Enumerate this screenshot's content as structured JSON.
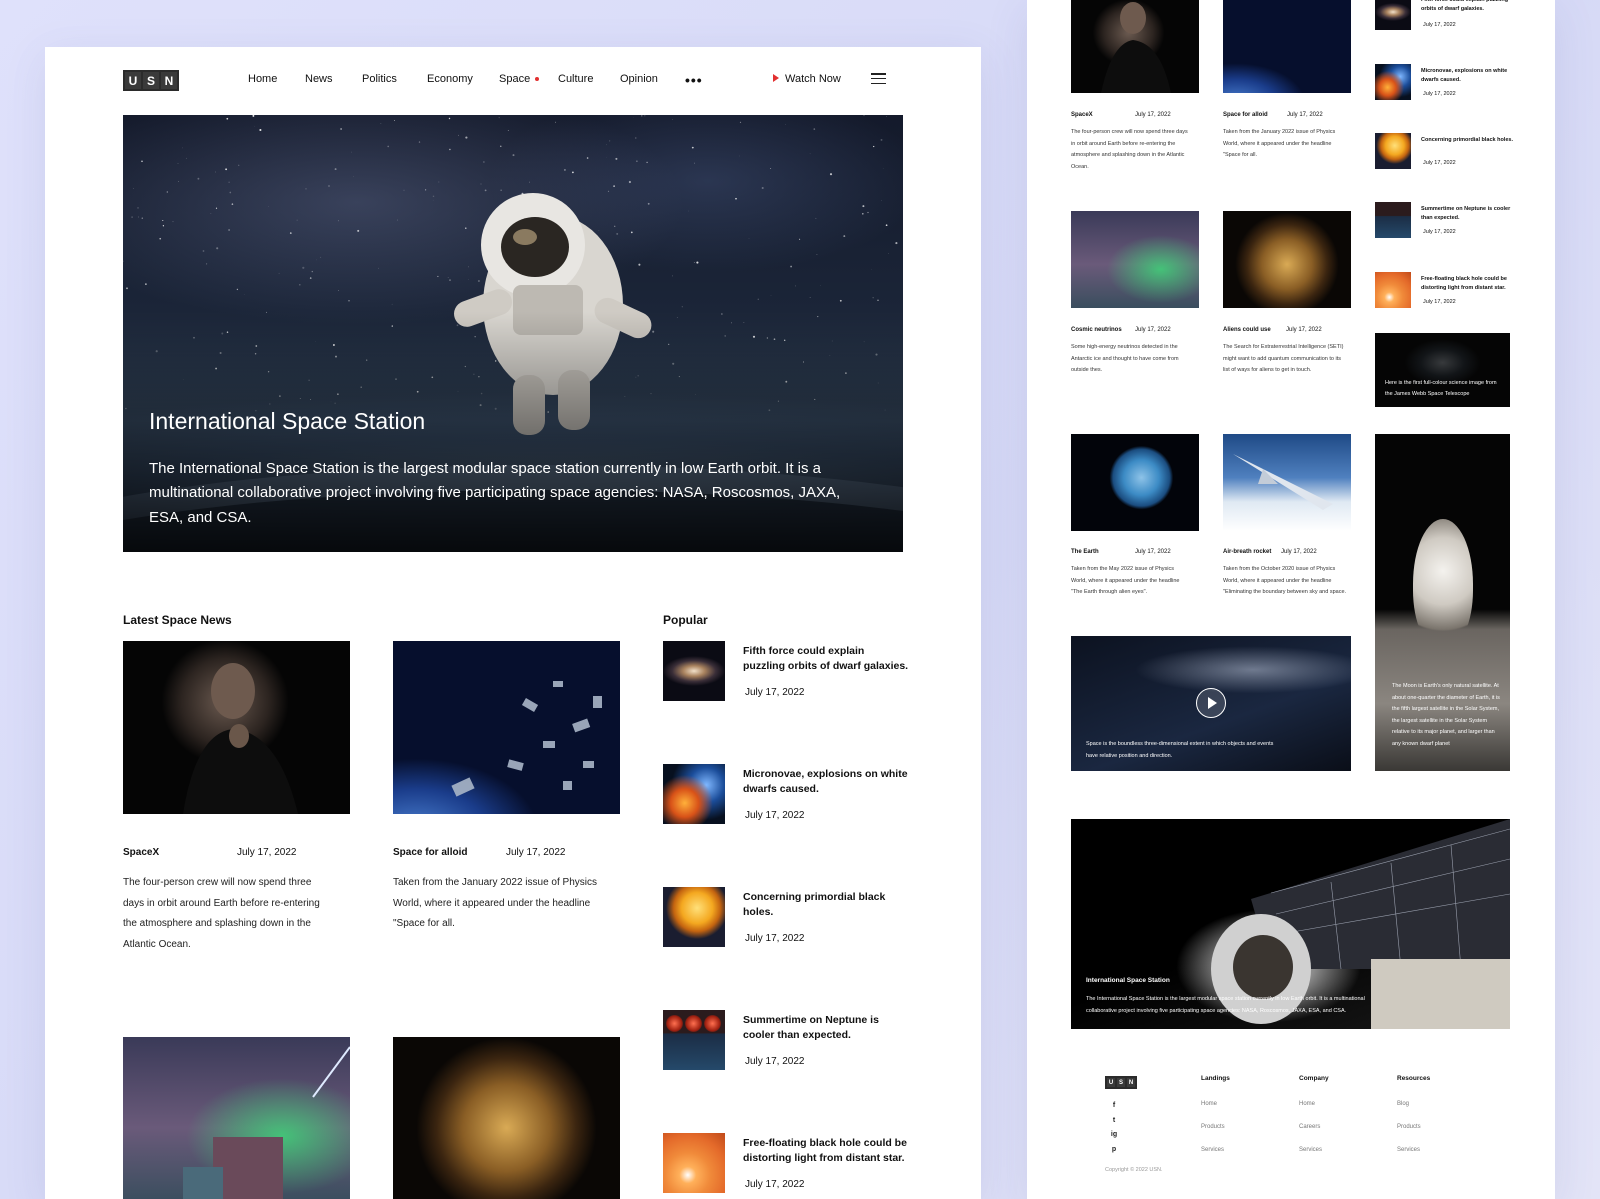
{
  "brand": {
    "letters": [
      "U",
      "S",
      "N"
    ]
  },
  "nav": {
    "items": [
      "Home",
      "News",
      "Politics",
      "Economy",
      "Space",
      "Culture",
      "Opinion"
    ],
    "active": "Space",
    "more_label": "•••",
    "watch_label": "Watch Now"
  },
  "hero": {
    "title": "International Space Station",
    "description": "The International Space Station is the largest modular space station currently in low Earth orbit. It is a multinational collaborative project involving five participating space agencies: NASA, Roscosmos, JAXA, ESA, and CSA."
  },
  "latest": {
    "title": "Latest Space News",
    "cards": [
      {
        "tag": "SpaceX",
        "date": "July 17, 2022",
        "desc": "The four-person crew will now spend three days in orbit around Earth before re-entering the atmosphere and splashing down in the Atlantic Ocean."
      },
      {
        "tag": "Space for alloid",
        "date": "July 17, 2022",
        "desc": "Taken from the January 2022 issue of Physics World, where it appeared under the headline \"Space for all."
      }
    ]
  },
  "popular": {
    "title": "Popular",
    "items": [
      {
        "title": "Fifth force could explain puzzling orbits of dwarf galaxies.",
        "date": "July 17, 2022"
      },
      {
        "title": "Micronovae, explosions on white dwarfs caused.",
        "date": "July 17, 2022"
      },
      {
        "title": "Concerning primordial black holes.",
        "date": "July 17, 2022"
      },
      {
        "title": "Summertime on Neptune is cooler than expected.",
        "date": "July 17, 2022"
      },
      {
        "title": "Free-floating black hole could be distorting light from distant star.",
        "date": "July 17, 2022"
      }
    ]
  },
  "right": {
    "cards": [
      {
        "tag": "SpaceX",
        "date": "July 17, 2022",
        "desc": "The four-person crew will now spend three days in orbit around Earth before re-entering the atmosphere and splashing down in the Atlantic Ocean."
      },
      {
        "tag": "Space for alloid",
        "date": "July 17, 2022",
        "desc": "Taken from the January 2022 issue of Physics World, where it appeared under the headline \"Space for all."
      },
      {
        "tag": "Cosmic neutrinos",
        "date": "July 17, 2022",
        "desc": "Some high-energy neutrinos detected in the Antarctic ice and thought to have come from outside thes."
      },
      {
        "tag": "Aliens could use",
        "date": "July 17, 2022",
        "desc": "The Search for Extraterrestrial Intelligence (SETI) might want to add quantum communication to its list of ways for aliens to get in touch."
      },
      {
        "tag": "The Earth",
        "date": "July 17, 2022",
        "desc": "Taken from the May 2022 issue of Physics World, where it appeared under the headline \"The Earth through alien eyes\"."
      },
      {
        "tag": "Air-breath rocket",
        "date": "July 17, 2022",
        "desc": "Taken from the October 2020 issue of Physics World, where it appeared under the headline \"Eliminating the boundary between sky and space."
      }
    ],
    "webb_caption": "Here is the first full-colour science image from the James Webb Space Telescope",
    "moon_caption": "The Moon is Earth's only natural satellite. At about one-quarter the diameter of Earth, it is the fifth largest satellite in the Solar System, the largest satellite in the Solar System relative to its major planet, and larger than any known dwarf planet",
    "video_caption": "Space is the boundless three-dimensional extent in which objects and events have relative position and direction.",
    "banner_title": "International Space Station",
    "banner_desc": "The International Space Station is the largest modular space station currently in low Earth orbit. It is a multinational collaborative project involving five participating space agencies: NASA, Roscosmos, JAXA, ESA, and CSA."
  },
  "footer": {
    "social": [
      "f",
      "t",
      "ig",
      "p"
    ],
    "columns": [
      {
        "title": "Landings",
        "links": [
          "Home",
          "Products",
          "Services"
        ]
      },
      {
        "title": "Company",
        "links": [
          "Home",
          "Careers",
          "Services"
        ]
      },
      {
        "title": "Resources",
        "links": [
          "Blog",
          "Products",
          "Services"
        ]
      }
    ],
    "copyright": "Copyright © 2022 USN."
  },
  "colors": {
    "accent": "#e23030",
    "text": "#111111"
  },
  "icons": [
    "play-icon",
    "menu-icon",
    "more-icon",
    "facebook-icon",
    "twitter-icon",
    "instagram-icon",
    "pinterest-icon"
  ]
}
